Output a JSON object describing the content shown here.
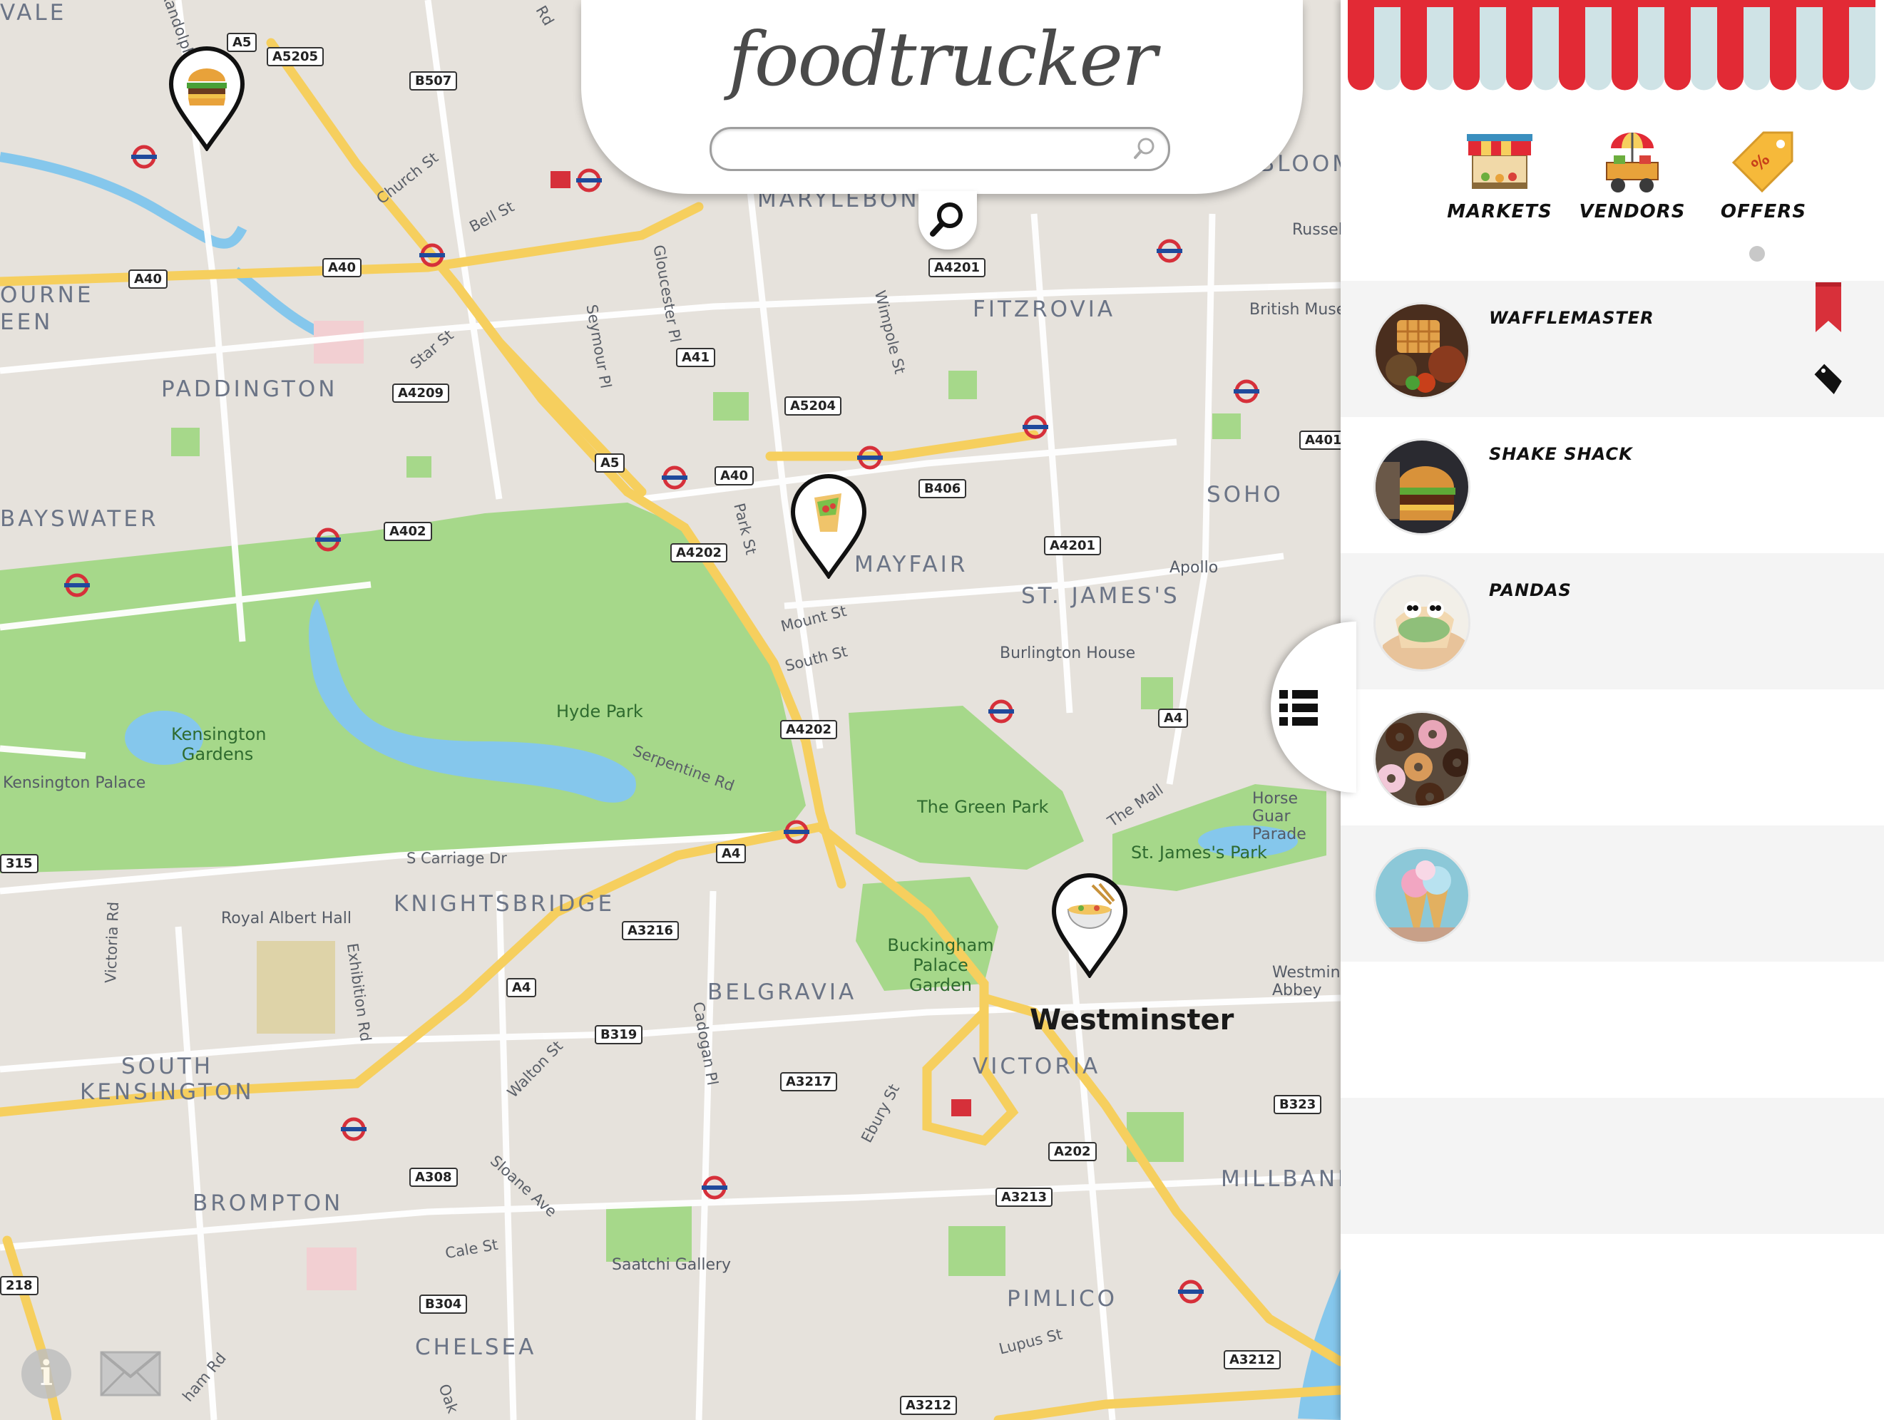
{
  "app": {
    "brand": "foodtrucker"
  },
  "search": {
    "placeholder": ""
  },
  "nav": {
    "tabs": [
      {
        "label": "MARKETS",
        "icon": "market-stall-icon"
      },
      {
        "label": "VENDORS",
        "icon": "food-cart-icon",
        "active": true
      },
      {
        "label": "OFFERS",
        "icon": "discount-tag-icon"
      }
    ]
  },
  "vendors": [
    {
      "name": "WAFFLEMASTER",
      "image": "waffles-photo",
      "bookmarked": true,
      "has_offer": true
    },
    {
      "name": "SHAKE SHACK",
      "image": "burger-photo"
    },
    {
      "name": "PANDAS",
      "image": "panda-bun-photo"
    },
    {
      "name": "",
      "image": "donuts-photo"
    },
    {
      "name": "",
      "image": "ice-cream-photo"
    }
  ],
  "map": {
    "districts": [
      "VALE",
      "OURNE",
      "EEN",
      "PADDINGTON",
      "BAYSWATER",
      "KNIGHTSBRIDGE",
      "SOUTH",
      "KENSINGTON",
      "BROMPTON",
      "CHELSEA",
      "BELGRAVIA",
      "MAYFAIR",
      "ST. JAMES'S",
      "FITZROVIA",
      "SOHO",
      "VICTORIA",
      "MILLBANK",
      "PIMLICO",
      "MARYLEBONE",
      "BLOOM"
    ],
    "big_label": "Westminster",
    "parks": [
      "Hyde Park",
      "Kensington Gardens",
      "The Green Park",
      "St. James's Park",
      "Buckingham Palace Garden"
    ],
    "pois": [
      "Kensington Palace",
      "Royal Albert Hall",
      "Saatchi Gallery",
      "Burlington House",
      "Apollo",
      "British Muse",
      "Horse Guar Parade",
      "Westmins Abbey",
      "Russel"
    ],
    "streets": [
      "Church St",
      "Bell St",
      "Star St",
      "Gloucester Pl",
      "Seymour Pl",
      "Wimpole St",
      "Park St",
      "Mount St",
      "South St",
      "Serpentine Rd",
      "S Carriage Dr",
      "The Mall",
      "Victoria Rd",
      "Exhibition Rd",
      "Walton St",
      "Cadogan Pl",
      "Sloane Ave",
      "Cale St",
      "Ebury St",
      "Lupus St",
      "Randolph",
      "Rd",
      "ham Rd",
      "Oak"
    ],
    "road_shields": [
      "A5",
      "A5205",
      "B507",
      "A40",
      "A40",
      "A41",
      "A4209",
      "A5204",
      "A4201",
      "A5",
      "A40",
      "B406",
      "A402",
      "A4202",
      "A4201",
      "A401",
      "A4202",
      "A4",
      "A4",
      "A3216",
      "A4",
      "B319",
      "A3217",
      "A202",
      "A3213",
      "B323",
      "A308",
      "B304",
      "A3212",
      "A3212",
      "315",
      "218"
    ],
    "markers": [
      {
        "name": "burger-marker",
        "icon": "burger-icon"
      },
      {
        "name": "wrap-marker",
        "icon": "wrap-icon"
      },
      {
        "name": "noodle-bowl-marker",
        "icon": "noodle-bowl-icon"
      }
    ]
  },
  "footer": {
    "info_label": "i"
  },
  "colors": {
    "awning_red": "#e22a35",
    "awning_light": "#cfe3e6",
    "park_green": "#a6d88a",
    "water_blue": "#85c7ec",
    "road_yellow": "#f6cf5e",
    "map_bg": "#e6e2dc",
    "bookmark_red": "#d8303a"
  }
}
